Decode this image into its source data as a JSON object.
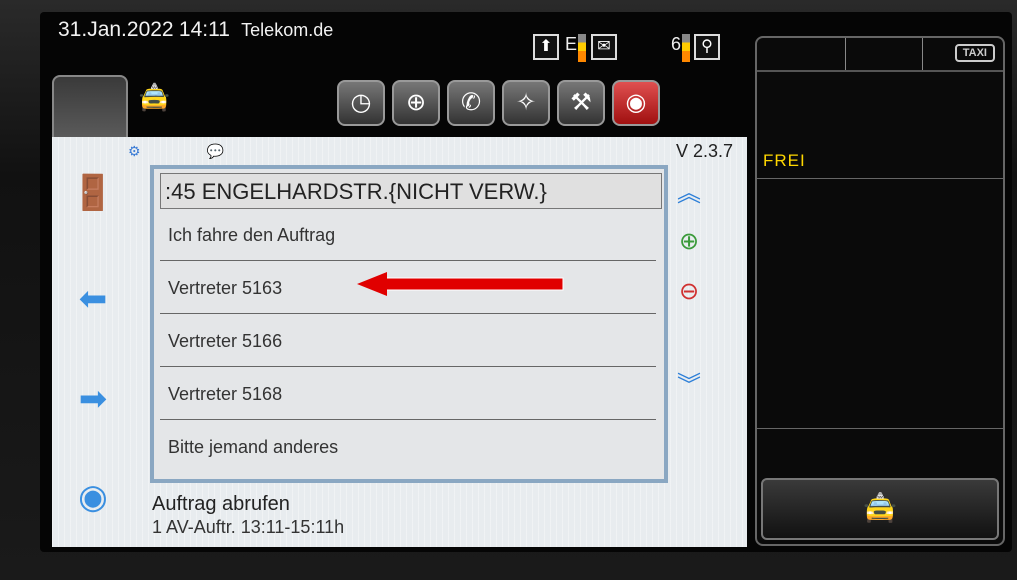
{
  "status_bar": {
    "date": "31.Jan.2022",
    "time": "14:11",
    "carrier": "Telekom.de",
    "indicator_e": "E",
    "indicator_6": "6"
  },
  "icons": {
    "car": "taxi-car-icon",
    "clock": "clock-icon",
    "compass": "compass-icon",
    "phone": "phone-icon",
    "satellite": "satellite-icon",
    "tools": "tools-icon",
    "emergency": "emergency-icon",
    "exit": "exit-door-icon",
    "back": "arrow-left-icon",
    "forward": "arrow-right-icon",
    "circles": "color-circles-icon",
    "scroll_up": "double-chevron-up-icon",
    "scroll_down": "double-chevron-down-icon",
    "zoom_in": "zoom-in-icon",
    "zoom_out": "zoom-out-icon"
  },
  "version": "V 2.3.7",
  "list": {
    "header": ":45 ENGELHARDSTR.{NICHT VERW.}",
    "items": [
      "Ich fahre den Auftrag",
      "Vertreter 5163",
      "Vertreter 5166",
      "Vertreter 5168",
      "Bitte jemand anderes"
    ]
  },
  "footer": {
    "line1": "Auftrag abrufen",
    "line2": "1 AV-Auftr. 13:11-15:11h"
  },
  "right_panel": {
    "taxi_label": "TAXI",
    "status": "FREI"
  },
  "colors": {
    "panel_bg": "#e8ecef",
    "list_border": "#8aa7c2",
    "status_frei": "#ffd700",
    "annotation_arrow": "#e00000"
  }
}
